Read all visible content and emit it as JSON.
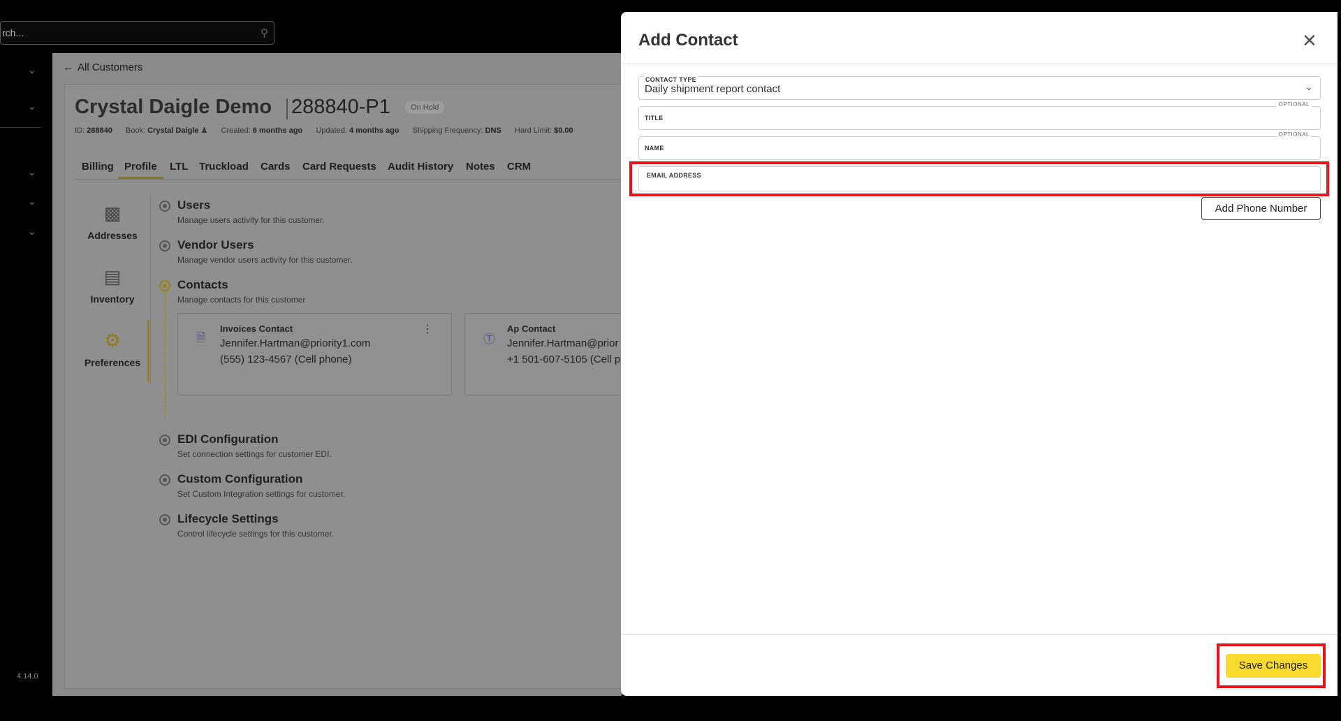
{
  "search": {
    "placeholder": "rch..."
  },
  "version": "4.14.0",
  "page": {
    "back_label": "All Customers",
    "customer_name": "Crystal Daigle Demo",
    "account_number": "288840-P1",
    "status_badge": "On Hold",
    "meta": {
      "id_label": "ID:",
      "id_value": "288840",
      "book_label": "Book:",
      "book_value": "Crystal Daigle",
      "created_label": "Created:",
      "created_value": "6 months ago",
      "updated_label": "Updated:",
      "updated_value": "4 months ago",
      "freq_label": "Shipping Frequency:",
      "freq_value": "DNS",
      "limit_label": "Hard Limit:",
      "limit_value": "$0.00"
    },
    "tabs": [
      "Billing",
      "Profile",
      "LTL",
      "Truckload",
      "Cards",
      "Card Requests",
      "Audit History",
      "Notes",
      "CRM"
    ],
    "left_nav": [
      "Addresses",
      "Inventory",
      "Preferences"
    ],
    "sections": [
      {
        "title": "Users",
        "subtitle": "Manage users activity for this customer."
      },
      {
        "title": "Vendor Users",
        "subtitle": "Manage vendor users activity for this customer."
      },
      {
        "title": "Contacts",
        "subtitle": "Manage contacts for this customer"
      },
      {
        "title": "EDI Configuration",
        "subtitle": "Set connection settings for customer EDI."
      },
      {
        "title": "Custom Configuration",
        "subtitle": "Set Custom Integration settings for customer."
      },
      {
        "title": "Lifecycle Settings",
        "subtitle": "Control lifecycle settings for this customer."
      }
    ],
    "contacts": [
      {
        "name": "Invoices Contact",
        "email": "Jennifer.Hartman@priority1.com",
        "phone": "(555) 123-4567 (Cell phone)"
      },
      {
        "name": "Ap Contact",
        "email": "Jennifer.Hartman@prior",
        "phone": "+1 501-607-5105 (Cell p"
      }
    ]
  },
  "modal": {
    "title": "Add Contact",
    "contact_type_label": "Contact Type",
    "contact_type_value": "Daily shipment report contact",
    "title_label": "Title",
    "name_label": "Name",
    "optional_label": "OPTIONAL",
    "email_label": "Email Address",
    "add_phone_label": "Add Phone Number",
    "save_label": "Save Changes"
  },
  "colors": {
    "accent": "#f8d92d",
    "highlight": "#e8141b",
    "overlay": "#8a8a8a"
  }
}
